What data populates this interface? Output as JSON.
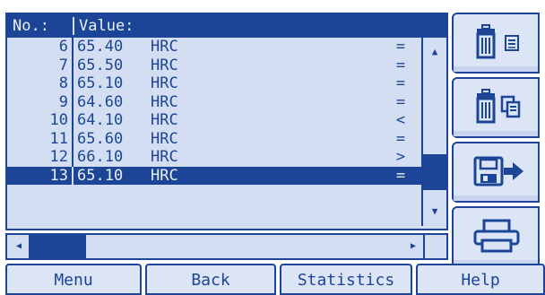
{
  "table": {
    "headers": {
      "no": "No.:",
      "value": "Value:"
    },
    "rows": [
      {
        "no": "6",
        "value": "65.40",
        "unit": "HRC",
        "flag": "="
      },
      {
        "no": "7",
        "value": "65.50",
        "unit": "HRC",
        "flag": "="
      },
      {
        "no": "8",
        "value": "65.10",
        "unit": "HRC",
        "flag": "="
      },
      {
        "no": "9",
        "value": "64.60",
        "unit": "HRC",
        "flag": "="
      },
      {
        "no": "10",
        "value": "64.10",
        "unit": "HRC",
        "flag": "<"
      },
      {
        "no": "11",
        "value": "65.60",
        "unit": "HRC",
        "flag": "="
      },
      {
        "no": "12",
        "value": "66.10",
        "unit": "HRC",
        "flag": ">"
      },
      {
        "no": "13",
        "value": "65.10",
        "unit": "HRC",
        "flag": "="
      }
    ],
    "selected_no": "13"
  },
  "side_buttons": [
    {
      "icon": "delete-single-icon"
    },
    {
      "icon": "delete-all-icon"
    },
    {
      "icon": "save-export-icon"
    },
    {
      "icon": "print-icon"
    }
  ],
  "menu": {
    "menu_label": "Menu",
    "back_label": "Back",
    "statistics_label": "Statistics",
    "help_label": "Help"
  },
  "colors": {
    "accent": "#1c4597",
    "panel": "#d3def3",
    "button": "#dbe5f6"
  }
}
